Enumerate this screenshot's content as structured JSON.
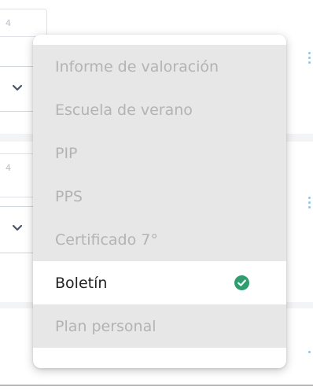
{
  "background": {
    "field_value_top": "4",
    "field_value_mid": "4"
  },
  "dropdown": {
    "items": [
      {
        "label": "Informe de valoración",
        "selected": false
      },
      {
        "label": "Escuela de verano",
        "selected": false
      },
      {
        "label": "PIP",
        "selected": false
      },
      {
        "label": "PPS",
        "selected": false
      },
      {
        "label": "Certificado 7°",
        "selected": false
      },
      {
        "label": "Boletín",
        "selected": true
      },
      {
        "label": "Plan personal",
        "selected": false
      }
    ],
    "check_icon": "check-circle-icon",
    "check_color": "#2e9e6e"
  }
}
